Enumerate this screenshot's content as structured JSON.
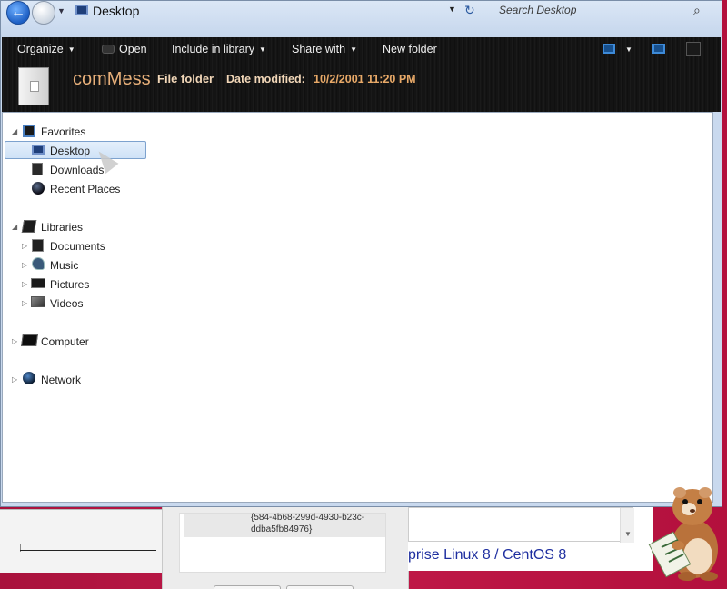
{
  "window": {
    "address": "Desktop",
    "search_placeholder": "Search Desktop"
  },
  "toolbar": {
    "organize": "Organize",
    "open": "Open",
    "include": "Include in library",
    "share": "Share with",
    "new_folder": "New folder"
  },
  "details": {
    "folder_name": "comMess",
    "folder_type": "File folder",
    "date_label": "Date modified:",
    "date_value": "10/2/2001 11:20 PM"
  },
  "nav": {
    "favorites": "Favorites",
    "desktop": "Desktop",
    "downloads": "Downloads",
    "recent": "Recent Places",
    "libraries": "Libraries",
    "documents": "Documents",
    "music": "Music",
    "pictures": "Pictures",
    "videos": "Videos",
    "computer": "Computer",
    "network": "Network"
  },
  "background": {
    "guid_fragment": "{584-4b68-299d-4930-b23c-ddba5fb84976}",
    "banner_text": "prise Linux 8 / CentOS 8"
  },
  "colors": {
    "toolbar_bg": "#151515",
    "folder_name": "#e8b07a",
    "date_value": "#e8a968",
    "selection": "#cfe2f7",
    "desktop_bg": "#b5123f",
    "banner_text": "#1f2fa0"
  },
  "icons": {
    "back": "back-arrow-icon",
    "forward": "forward-arrow-icon",
    "refresh": "refresh-icon",
    "search": "search-icon",
    "views": "views-icon",
    "preview": "preview-pane-icon",
    "help": "help-icon"
  }
}
